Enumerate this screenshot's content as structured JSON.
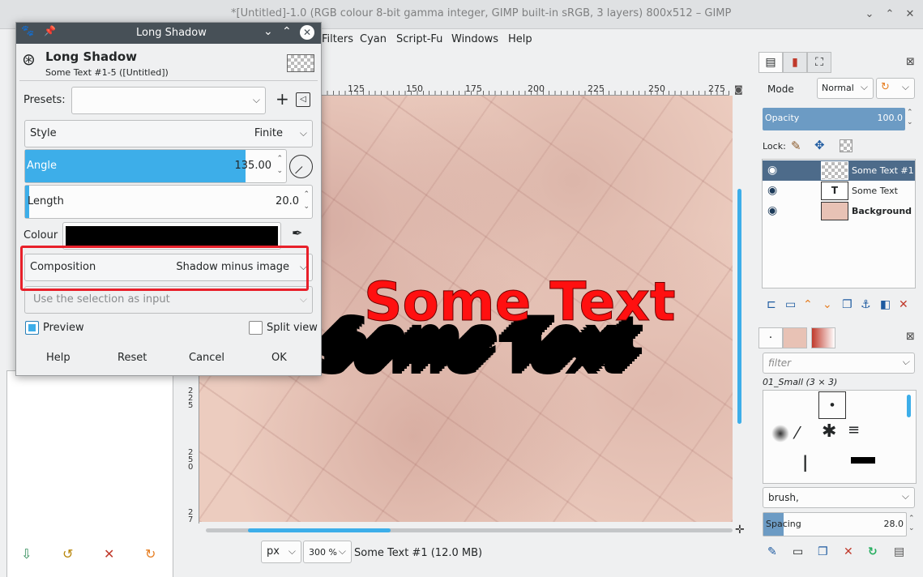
{
  "main_window": {
    "title": "*[Untitled]-1.0 (RGB colour 8-bit gamma integer, GIMP built-in sRGB, 3 layers) 800x512 – GIMP",
    "menu": [
      "Filters",
      "Cyan",
      "Script-Fu",
      "Windows",
      "Help"
    ]
  },
  "dialog": {
    "window_title": "Long Shadow",
    "header_title": "Long Shadow",
    "header_subtitle": "Some Text #1-5 ([Untitled])",
    "presets_label": "Presets:",
    "presets_value": "",
    "style_label": "Style",
    "style_value": "Finite",
    "angle_label": "Angle",
    "angle_value": "135.00",
    "length_label": "Length",
    "length_value": "20.0",
    "colour_label": "Colour",
    "colour_value": "#000000",
    "composition_label": "Composition",
    "composition_value": "Shadow minus image",
    "selection_input": "Use the selection as input",
    "preview_label": "Preview",
    "preview_checked": true,
    "split_view_label": "Split view",
    "split_view_checked": false,
    "buttons": {
      "help": "Help",
      "reset": "Reset",
      "cancel": "Cancel",
      "ok": "OK"
    }
  },
  "ruler": {
    "h_ticks": [
      "125",
      "150",
      "175",
      "200",
      "225",
      "250",
      "275"
    ]
  },
  "canvas": {
    "text": "Some Text"
  },
  "statusbar": {
    "unit": "px",
    "zoom": "300 %",
    "info": "Some Text #1 (12.0 MB)"
  },
  "layers_panel": {
    "mode_label": "Mode",
    "mode_value": "Normal",
    "opacity_label": "Opacity",
    "opacity_value": "100.0",
    "opacity_fraction": 1.0,
    "lock_label": "Lock:",
    "layers": [
      {
        "name": "Some Text #1",
        "selected": true
      },
      {
        "name": "Some Text",
        "selected": false
      },
      {
        "name": "Background",
        "selected": false
      }
    ]
  },
  "brushes_panel": {
    "filter_placeholder": "filter",
    "brush_name": "01_Small (3 × 3)",
    "brush_tag": "brush,",
    "spacing_label": "Spacing",
    "spacing_value": "28.0"
  }
}
